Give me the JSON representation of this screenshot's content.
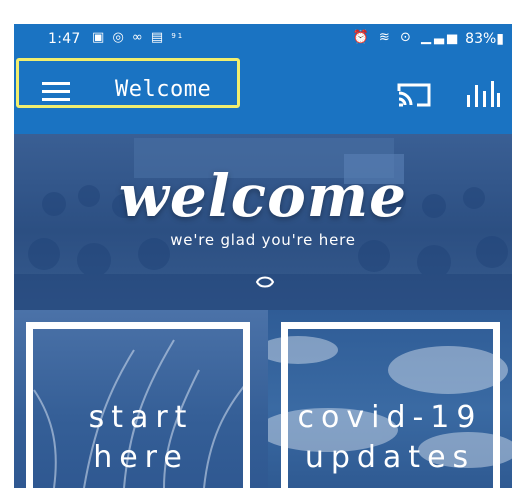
{
  "status_bar": {
    "time": "1:47",
    "signal_small_label": "91",
    "battery": "83%",
    "icons_left": [
      "photo-icon",
      "instagram-icon",
      "link-icon",
      "cast-notification-icon"
    ],
    "icons_right": [
      "alarm-icon",
      "wifi-icon",
      "hotspot-icon",
      "cell-signal-icon",
      "battery-icon"
    ]
  },
  "app_bar": {
    "title": "Welcome",
    "color": "#1a73c2",
    "highlight_color": "#f2ee6e",
    "icons": [
      "menu-icon",
      "cast-icon",
      "audio-icon"
    ]
  },
  "hero": {
    "title": "welcome",
    "subtitle": "we're glad you're here",
    "logo_icon": "church-logo-icon"
  },
  "tiles": [
    {
      "label_line1": "start",
      "label_line2": "here"
    },
    {
      "label_line1": "covid-19",
      "label_line2": "updates"
    }
  ]
}
